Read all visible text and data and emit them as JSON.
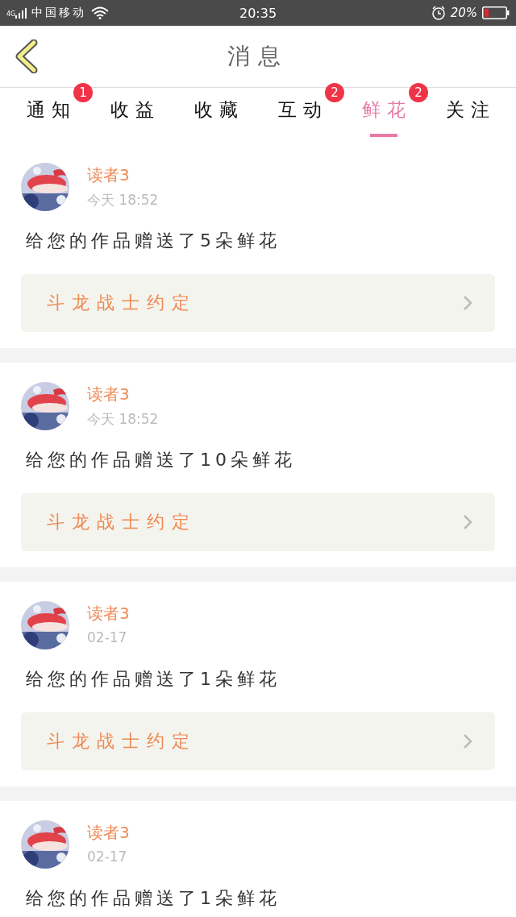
{
  "status_bar": {
    "network": "4G",
    "carrier": "中国移动",
    "time": "20:35",
    "battery": "20%"
  },
  "header": {
    "title": "消息"
  },
  "tabs": [
    {
      "label": "通知",
      "badge": "1",
      "selected": false
    },
    {
      "label": "收益",
      "selected": false
    },
    {
      "label": "收藏",
      "selected": false
    },
    {
      "label": "互动",
      "badge": "2",
      "selected": false
    },
    {
      "label": "鲜花",
      "badge": "2",
      "selected": true
    },
    {
      "label": "关注",
      "selected": false
    }
  ],
  "messages": [
    {
      "sender": "读者3",
      "time": "今天 18:52",
      "text": "给您的作品赠送了5朵鲜花",
      "book": "斗龙战士约定"
    },
    {
      "sender": "读者3",
      "time": "今天 18:52",
      "text": "给您的作品赠送了10朵鲜花",
      "book": "斗龙战士约定"
    },
    {
      "sender": "读者3",
      "time": "02-17",
      "text": "给您的作品赠送了1朵鲜花",
      "book": "斗龙战士约定"
    },
    {
      "sender": "读者3",
      "time": "02-17",
      "text": "给您的作品赠送了1朵鲜花"
    }
  ]
}
